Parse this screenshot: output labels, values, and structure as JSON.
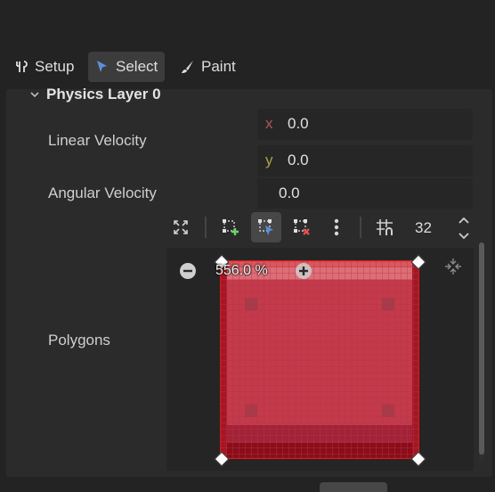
{
  "toolbar_modes": [
    {
      "label": "Setup",
      "icon": "wrench-icon",
      "active": false
    },
    {
      "label": "Select",
      "icon": "cursor-icon",
      "active": true
    },
    {
      "label": "Paint",
      "icon": "brush-icon",
      "active": false
    }
  ],
  "section": {
    "title": "Physics Layer 0"
  },
  "properties": {
    "linear_velocity": {
      "label": "Linear Velocity",
      "x_axis": "x",
      "x_value": "0.0",
      "y_axis": "y",
      "y_value": "0.0"
    },
    "angular_velocity": {
      "label": "Angular Velocity",
      "value": "0.0"
    },
    "polygons": {
      "label": "Polygons"
    }
  },
  "polygon_editor": {
    "grid_snap_value": "32",
    "zoom_label": "556.0 %",
    "tools": [
      "expand-icon",
      "add-points-icon",
      "edit-points-icon",
      "delete-points-icon",
      "more-options-icon",
      "grid-snap-icon"
    ]
  },
  "colors": {
    "accent": "#5c8fe0",
    "axis_x": "#b0545f",
    "axis_y": "#a7a147",
    "polygon_fill": "#c43a4a",
    "tile_border": "#d21b1b"
  }
}
